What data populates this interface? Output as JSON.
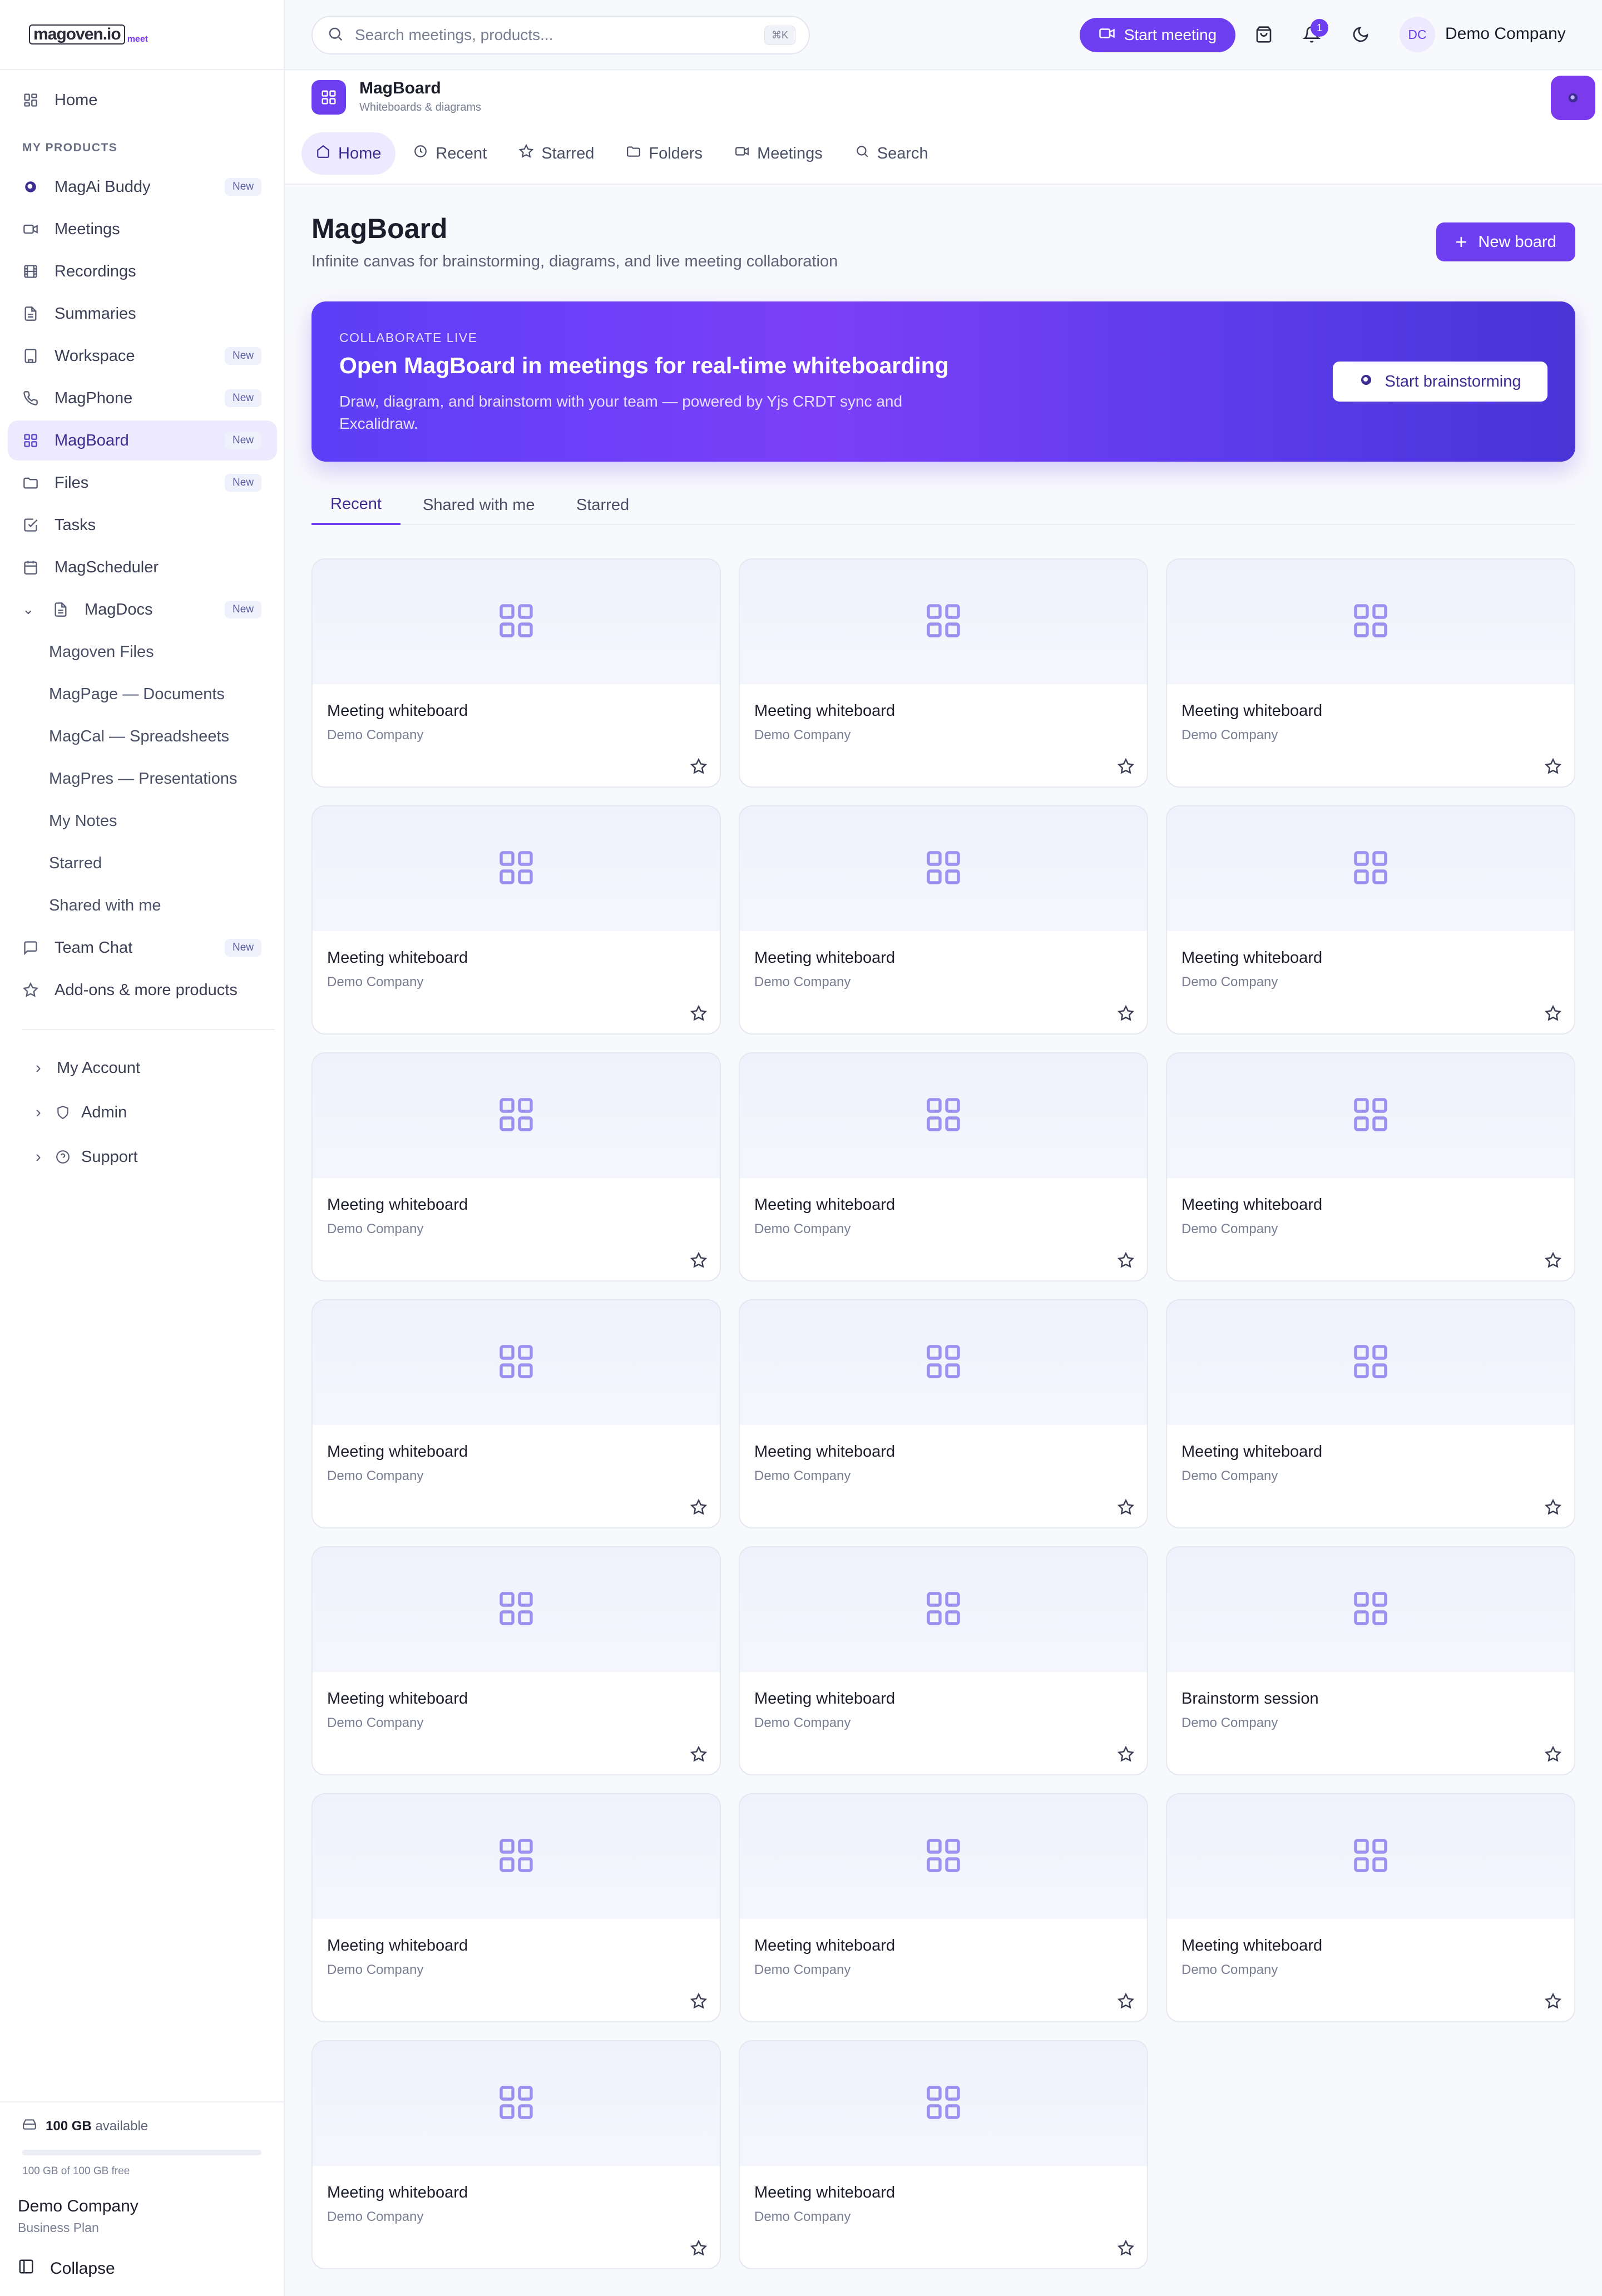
{
  "brand": {
    "logo_main": "magoven.io",
    "logo_sub": "meet"
  },
  "sidebar": {
    "home": "Home",
    "section_label": "MY PRODUCTS",
    "items": [
      {
        "label": "MagAi Buddy",
        "badge": "New",
        "icon": "ai-icon"
      },
      {
        "label": "Meetings",
        "badge": "",
        "icon": "video-icon"
      },
      {
        "label": "Recordings",
        "badge": "",
        "icon": "film-icon"
      },
      {
        "label": "Summaries",
        "badge": "",
        "icon": "document-icon"
      },
      {
        "label": "Workspace",
        "badge": "New",
        "icon": "building-icon"
      },
      {
        "label": "MagPhone",
        "badge": "New",
        "icon": "phone-icon"
      },
      {
        "label": "MagBoard",
        "badge": "New",
        "icon": "grid-icon"
      },
      {
        "label": "Files",
        "badge": "New",
        "icon": "folder-icon"
      },
      {
        "label": "Tasks",
        "badge": "",
        "icon": "checkbox-icon"
      },
      {
        "label": "MagScheduler",
        "badge": "",
        "icon": "calendar-icon"
      },
      {
        "label": "MagDocs",
        "badge": "New",
        "icon": "document-icon"
      }
    ],
    "magdocs_children": [
      "Magoven Files",
      "MagPage — Documents",
      "MagCal — Spreadsheets",
      "MagPres — Presentations",
      "My Notes",
      "Starred",
      "Shared with me"
    ],
    "team_chat": {
      "label": "Team Chat",
      "badge": "New"
    },
    "addons": "Add-ons & more products",
    "my_account": "My Account",
    "admin": "Admin",
    "support": "Support",
    "storage": {
      "amount": "100 GB",
      "suffix": "available",
      "detail": "100 GB of 100 GB free",
      "used_fraction": 0
    },
    "company": {
      "name": "Demo Company",
      "plan": "Business Plan"
    },
    "collapse": "Collapse"
  },
  "topbar": {
    "search_placeholder": "Search meetings, products...",
    "shortcut": "⌘K",
    "start_meeting": "Start meeting",
    "notification_count": "1",
    "avatar_initials": "DC",
    "account_name": "Demo Company"
  },
  "app": {
    "name": "MagBoard",
    "subtitle": "Whiteboards & diagrams",
    "tabs": [
      "Home",
      "Recent",
      "Starred",
      "Folders",
      "Meetings",
      "Search"
    ],
    "active_tab": "Home"
  },
  "page": {
    "title": "MagBoard",
    "subtitle": "Infinite canvas for brainstorming, diagrams, and live meeting collaboration",
    "new_board": "New board"
  },
  "banner": {
    "eyebrow": "COLLABORATE LIVE",
    "heading": "Open MagBoard in meetings for real-time whiteboarding",
    "description": "Draw, diagram, and brainstorm with your team — powered by Yjs CRDT sync and Excalidraw.",
    "button": "Start brainstorming"
  },
  "board_tabs": [
    "Recent",
    "Shared with me",
    "Starred"
  ],
  "boards": [
    {
      "title": "Meeting whiteboard",
      "owner": "Demo Company"
    },
    {
      "title": "Meeting whiteboard",
      "owner": "Demo Company"
    },
    {
      "title": "Meeting whiteboard",
      "owner": "Demo Company"
    },
    {
      "title": "Meeting whiteboard",
      "owner": "Demo Company"
    },
    {
      "title": "Meeting whiteboard",
      "owner": "Demo Company"
    },
    {
      "title": "Meeting whiteboard",
      "owner": "Demo Company"
    },
    {
      "title": "Meeting whiteboard",
      "owner": "Demo Company"
    },
    {
      "title": "Meeting whiteboard",
      "owner": "Demo Company"
    },
    {
      "title": "Meeting whiteboard",
      "owner": "Demo Company"
    },
    {
      "title": "Meeting whiteboard",
      "owner": "Demo Company"
    },
    {
      "title": "Meeting whiteboard",
      "owner": "Demo Company"
    },
    {
      "title": "Meeting whiteboard",
      "owner": "Demo Company"
    },
    {
      "title": "Meeting whiteboard",
      "owner": "Demo Company"
    },
    {
      "title": "Meeting whiteboard",
      "owner": "Demo Company"
    },
    {
      "title": "Brainstorm session",
      "owner": "Demo Company"
    },
    {
      "title": "Meeting whiteboard",
      "owner": "Demo Company"
    },
    {
      "title": "Meeting whiteboard",
      "owner": "Demo Company"
    },
    {
      "title": "Meeting whiteboard",
      "owner": "Demo Company"
    },
    {
      "title": "Meeting whiteboard",
      "owner": "Demo Company"
    },
    {
      "title": "Meeting whiteboard",
      "owner": "Demo Company"
    }
  ],
  "colors": {
    "accent": "#6d3ff0",
    "accent_soft": "#ede9fe",
    "banner_start": "#5b3ff6",
    "banner_end": "#4a34d6"
  }
}
